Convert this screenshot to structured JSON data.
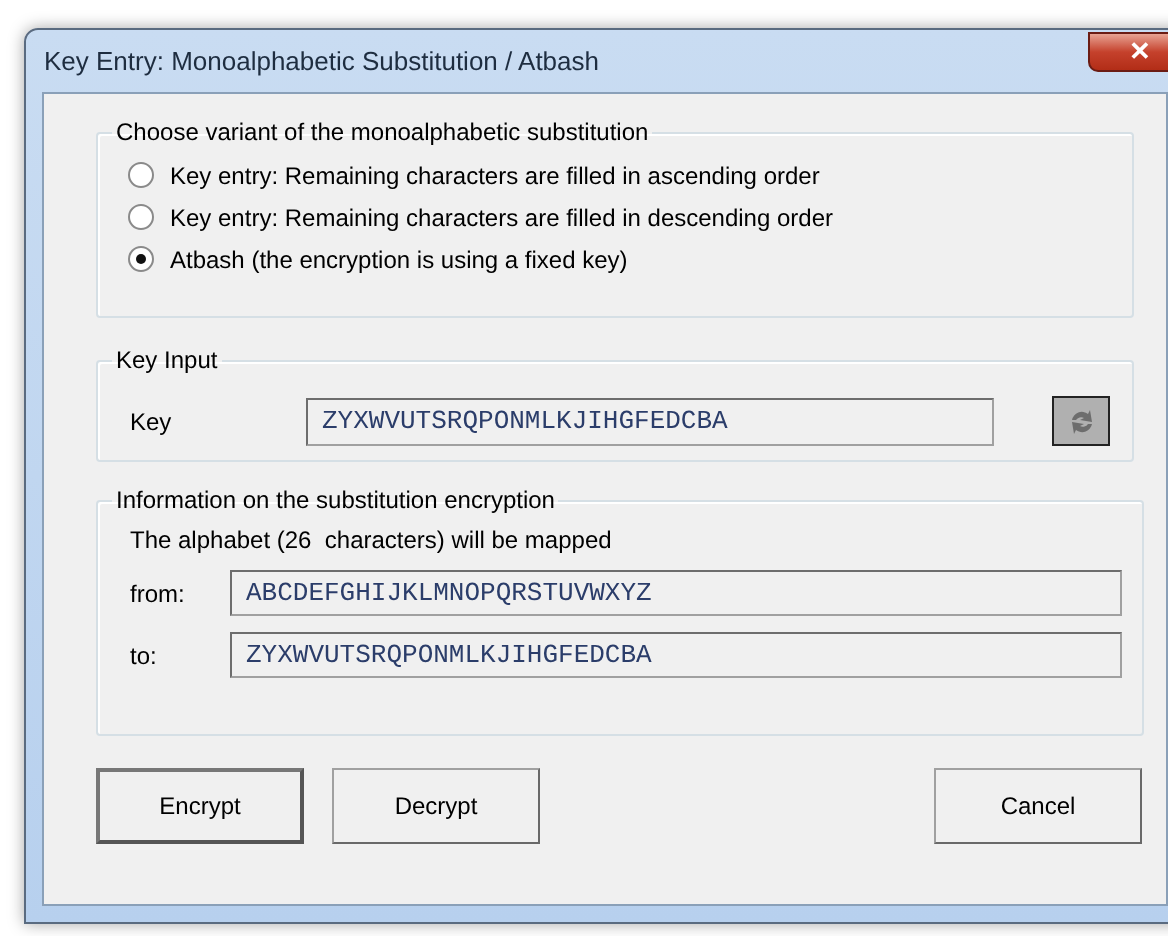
{
  "window": {
    "title": "Key Entry: Monoalphabetic Substitution / Atbash",
    "close": "✕"
  },
  "variant_group": {
    "title": "Choose variant of the monoalphabetic substitution",
    "options": [
      {
        "label": "Key entry: Remaining characters are filled in ascending order",
        "selected": false
      },
      {
        "label": "Key entry: Remaining characters are filled in descending order",
        "selected": false
      },
      {
        "label": "Atbash (the encryption is using a fixed key)",
        "selected": true
      }
    ]
  },
  "key_group": {
    "title": "Key Input",
    "label": "Key",
    "value": "ZYXWVUTSRQPONMLKJIHGFEDCBA",
    "button_disabled": true
  },
  "info_group": {
    "title": "Information on the substitution encryption",
    "description": "The alphabet (26  characters) will be mapped",
    "rows": [
      {
        "label": "from:",
        "value": "ABCDEFGHIJKLMNOPQRSTUVWXYZ"
      },
      {
        "label": "to:",
        "value": "ZYXWVUTSRQPONMLKJIHGFEDCBA"
      }
    ]
  },
  "buttons": [
    {
      "label": "Encrypt",
      "default": true
    },
    {
      "label": "Decrypt",
      "default": false
    },
    {
      "label": "Cancel",
      "default": false
    }
  ]
}
